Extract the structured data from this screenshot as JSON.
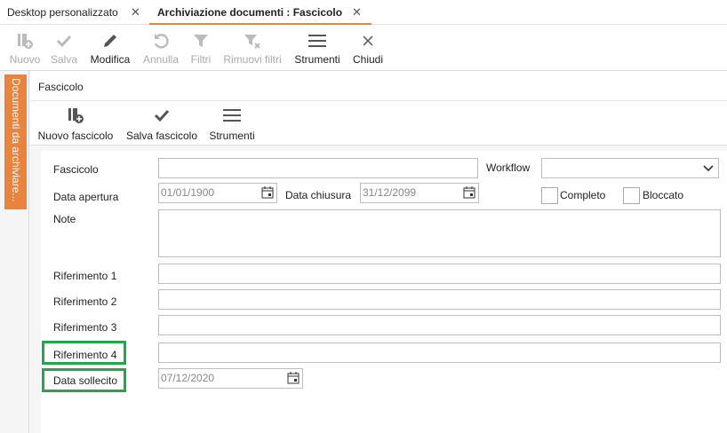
{
  "tabs": [
    {
      "label": "Desktop personalizzato",
      "close": "✕"
    },
    {
      "label": "Archiviazione documenti : Fascicolo",
      "close": "✕"
    }
  ],
  "toolbar": {
    "nuovo": "Nuovo",
    "salva": "Salva",
    "modifica": "Modifica",
    "annulla": "Annulla",
    "filtri": "Filtri",
    "rimuovi_filtri": "Rimuovi filtri",
    "strumenti": "Strumenti",
    "chiudi": "Chiudi"
  },
  "side_tab": "Documenti da archiviare...",
  "section_title": "Fascicolo",
  "section_toolbar": {
    "nuovo_fascicolo": "Nuovo fascicolo",
    "salva_fascicolo": "Salva fascicolo",
    "strumenti": "Strumenti"
  },
  "form": {
    "fascicolo_label": "Fascicolo",
    "fascicolo_value": "",
    "workflow_label": "Workflow",
    "workflow_value": "",
    "data_apertura_label": "Data apertura",
    "data_apertura_value": "01/01/1900",
    "data_chiusura_label": "Data chiusura",
    "data_chiusura_value": "31/12/2099",
    "completo_label": "Completo",
    "bloccato_label": "Bloccato",
    "note_label": "Note",
    "note_value": "",
    "rif1_label": "Riferimento 1",
    "rif2_label": "Riferimento 2",
    "rif3_label": "Riferimento 3",
    "rif4_label": "Riferimento 4",
    "data_sollecito_label": "Data sollecito",
    "data_sollecito_value": "07/12/2020"
  },
  "colors": {
    "accent": "#e9833e",
    "highlight": "#22a845"
  }
}
